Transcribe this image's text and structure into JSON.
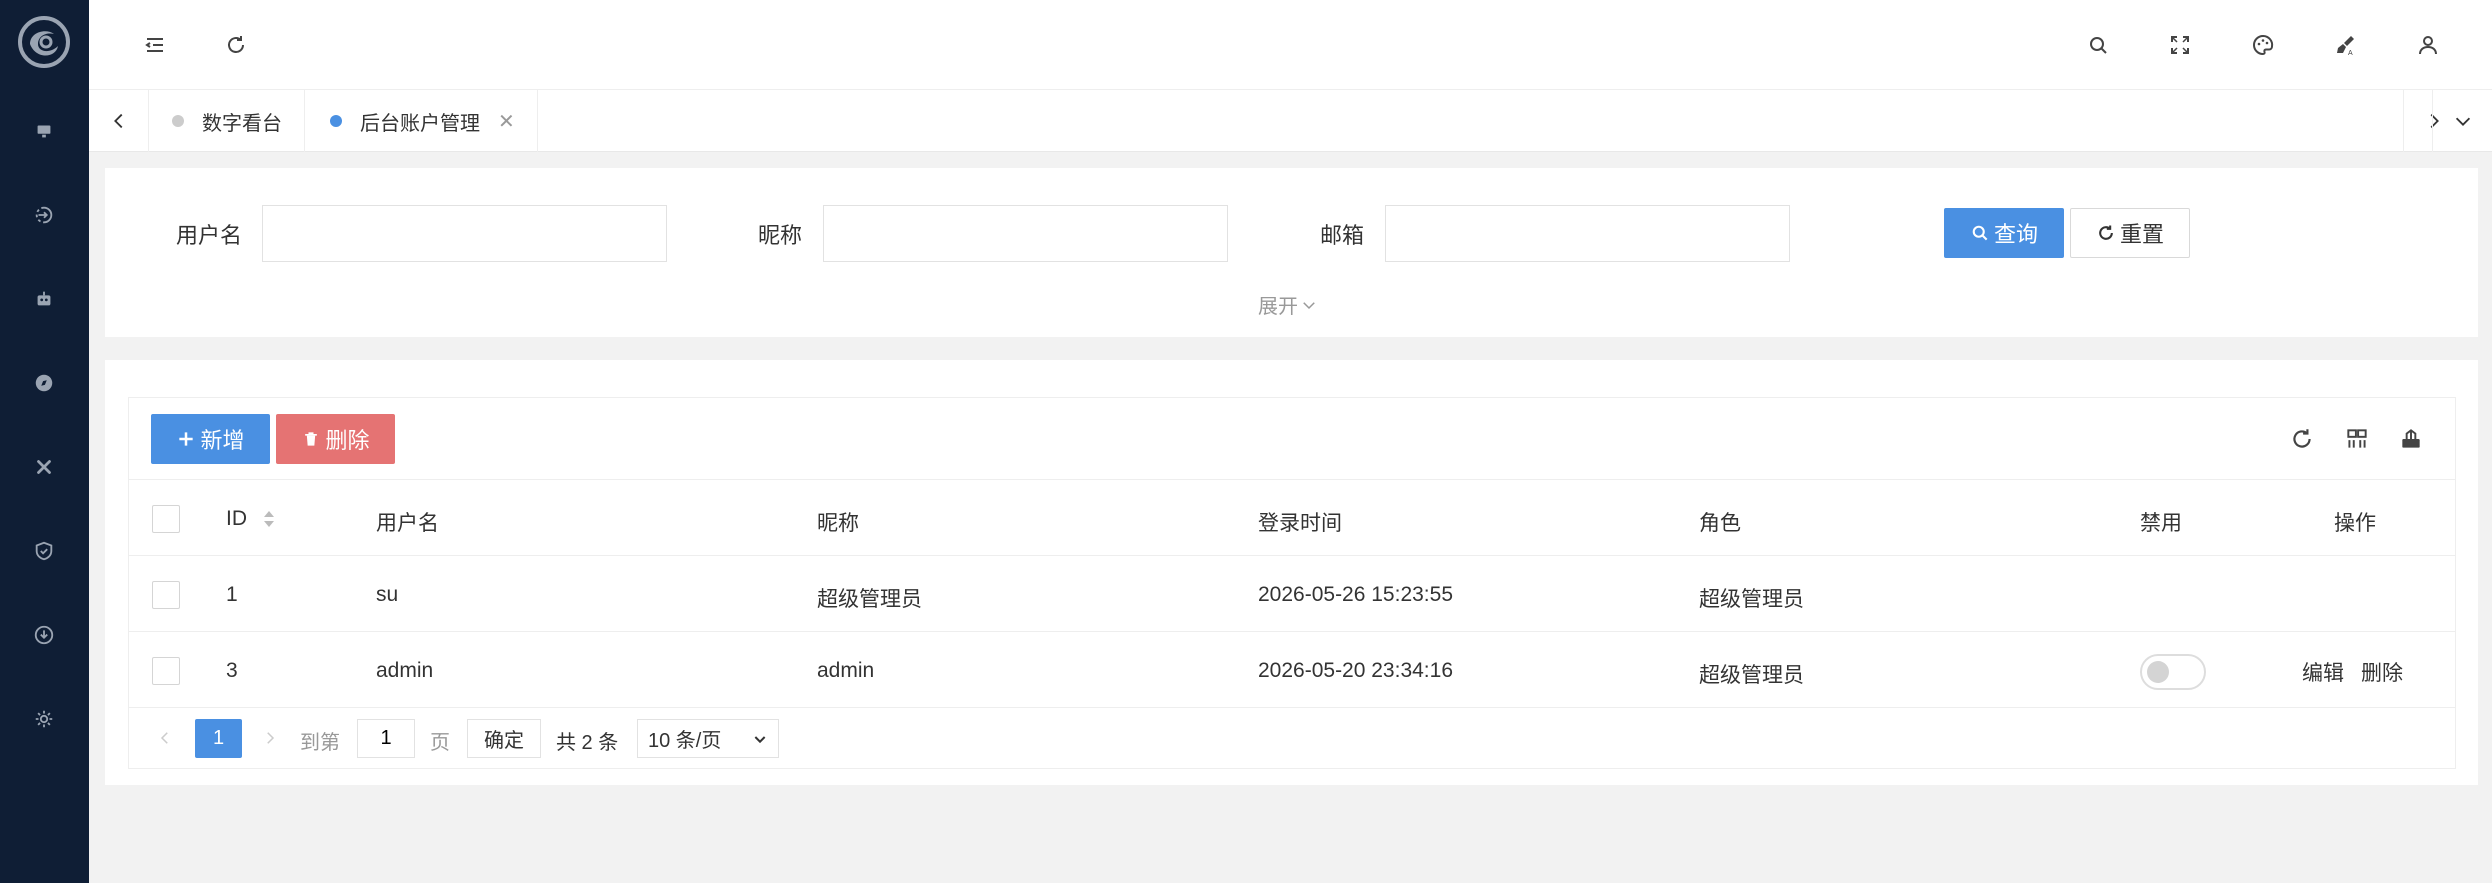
{
  "tabs": [
    {
      "label": "数字看台",
      "active": false,
      "dot_color": "#cccccc"
    },
    {
      "label": "后台账户管理",
      "active": true,
      "dot_color": "#4a90e2",
      "close": "✕"
    }
  ],
  "search": {
    "username_label": "用户名",
    "username_value": "",
    "nickname_label": "昵称",
    "nickname_value": "",
    "email_label": "邮箱",
    "email_value": "",
    "query_label": "查询",
    "reset_label": "重置",
    "expand_label": "展开"
  },
  "toolbar": {
    "add_label": "新增",
    "delete_label": "删除"
  },
  "table": {
    "columns": [
      "ID",
      "用户名",
      "昵称",
      "登录时间",
      "角色",
      "禁用",
      "操作"
    ],
    "rows": [
      {
        "id": "1",
        "username": "su",
        "nickname": "超级管理员",
        "login_time": "2026-05-26 15:23:55",
        "role": "超级管理员"
      },
      {
        "id": "3",
        "username": "admin",
        "nickname": "admin",
        "login_time": "2026-05-20 23:34:16",
        "role": "超级管理员",
        "disabled": false,
        "edit": "编辑",
        "delete": "删除"
      }
    ]
  },
  "pagination": {
    "current_page": "1",
    "goto_label": "到第",
    "goto_value": "1",
    "page_label": "页",
    "confirm_label": "确定",
    "total_label": "共 2 条",
    "page_size": "10 条/页"
  },
  "colors": {
    "sidebar_bg": "#0f1e35",
    "primary": "#4a90e2",
    "danger": "#e57373"
  }
}
